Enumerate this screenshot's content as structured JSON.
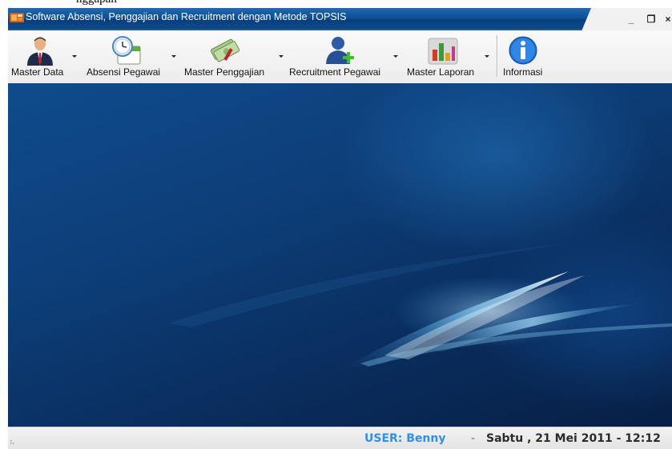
{
  "window": {
    "title": "Software Absensi, Penggajian dan Recruitment dengan Metode TOPSIS",
    "controls": {
      "minimize": "_",
      "restore": "❐",
      "close": "×"
    }
  },
  "toolbar": {
    "items": [
      {
        "label": "Master Data",
        "icon": "person-suit-icon",
        "has_dropdown": true
      },
      {
        "label": "Absensi Pegawai",
        "icon": "clock-calendar-icon",
        "has_dropdown": true
      },
      {
        "label": "Master Penggajian",
        "icon": "money-icon",
        "has_dropdown": true
      },
      {
        "label": "Recruitment Pegawai",
        "icon": "add-user-icon",
        "has_dropdown": true
      },
      {
        "label": "Master Laporan",
        "icon": "bar-chart-icon",
        "has_dropdown": true
      },
      {
        "label": "Informasi",
        "icon": "info-icon",
        "has_dropdown": false
      }
    ]
  },
  "status": {
    "user": "USER: Benny",
    "separator": "-",
    "datetime": "Sabtu , 21 Mei 2011 - 12:12"
  },
  "colors": {
    "title_bar": "#0b4d94",
    "desktop": "#0d3f7a",
    "user_text": "#2f8fea"
  }
}
